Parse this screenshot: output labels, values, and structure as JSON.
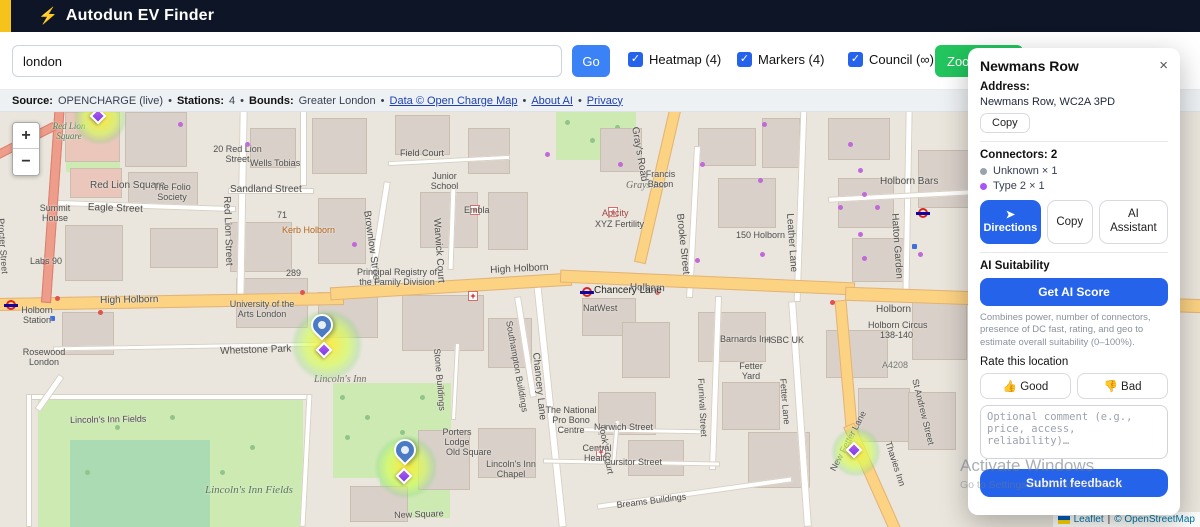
{
  "icons": {
    "logo": "⚡",
    "check": "✓",
    "directions_arrow": "➤",
    "thumb_up": "👍",
    "thumb_down": "👎"
  },
  "header": {
    "title": "Autodun EV Finder"
  },
  "toolbar": {
    "search_value": "london",
    "go_label": "Go",
    "checkboxes": [
      {
        "label": "Heatmap (4)"
      },
      {
        "label": "Markers (4)"
      },
      {
        "label": "Council (∞)"
      }
    ],
    "zoom_fit_label": "Zoo"
  },
  "infobar": {
    "source_label": "Source:",
    "source_value": "OPENCHARGE (live)",
    "sep": "•",
    "stations_label": "Stations:",
    "stations_value": "4",
    "bounds_label": "Bounds:",
    "bounds_value": "Greater London",
    "links": [
      "Data © Open Charge Map",
      "About AI",
      "Privacy"
    ]
  },
  "map": {
    "zoom_in": "+",
    "zoom_out": "−",
    "attribution": {
      "leaflet": "Leaflet",
      "sep": "|",
      "osm": "© OpenStreetMap"
    },
    "labels": [
      "High Holborn",
      "High Holborn",
      "Holborn",
      "Holborn",
      "Holborn Circus",
      "Chancery Lane",
      "Chancery Lane",
      "Lincoln's Inn Fields",
      "Lincoln's Inn",
      "Whetstone Park",
      "Lincoln's Inn Fields",
      "Red Lion Square",
      "Eagle Street",
      "Sandland Street",
      "Red Lion Street",
      "Brownlow Street",
      "Warwick Court",
      "Gray's Road",
      "Grays Inn",
      "Brooke Street",
      "Leather Lane",
      "Hatton Garden",
      "Holborn Bars",
      "Field Court",
      "The Folio Society",
      "20 Red Lion Street",
      "Wells Tobias",
      "Kerb Holborn",
      "Embla",
      "Apicity",
      "XYZ Fertility",
      "150 Holborn",
      "Junior School",
      "Francis Bacon",
      "University of the Arts London",
      "Principal Registry of the Family Division",
      "NatWest",
      "Southampton Buildings",
      "Stone Buildings",
      "Furnival Street",
      "Fetter Lane",
      "New Fetter Lane",
      "Norwich Street",
      "Cursitor Street",
      "Breams Buildings",
      "Old Square",
      "New Square",
      "Porters Lodge",
      "Lincoln's Inn Chapel",
      "The National Pro Bono Centre",
      "Central Health",
      "Barnards Inn",
      "HSBC UK",
      "Fetter Yard",
      "Holborn Station",
      "Rosewood London",
      "Summit House",
      "Labs 90",
      "St Andrew Street",
      "Thavies Inn",
      "A4208",
      "Red Lion Square",
      "Took's Court",
      "Procter Street",
      "71",
      "289",
      "138-140"
    ]
  },
  "panel": {
    "title": "Newmans Row",
    "close": "×",
    "address_label": "Address:",
    "address": "Newmans Row, WC2A 3PD",
    "copy_small": "Copy",
    "connectors_label": "Connectors: 2",
    "connectors": [
      {
        "name": "Unknown × 1"
      },
      {
        "name": "Type 2 × 1"
      }
    ],
    "directions": "Directions",
    "copy": "Copy",
    "ai_assistant": "AI Assistant",
    "ai_suitability": "AI Suitability",
    "get_ai_score": "Get AI Score",
    "ai_note": "Combines power, number of connectors, presence of DC fast, rating, and geo to estimate overall suitability (0–100%).",
    "rate_label": "Rate this location",
    "good": "Good",
    "bad": "Bad",
    "comment_placeholder": "Optional comment (e.g., price, access, reliability)…",
    "submit": "Submit feedback"
  },
  "watermark": {
    "line1": "Activate Windows",
    "line2": "Go to Settings to activate Windows."
  }
}
